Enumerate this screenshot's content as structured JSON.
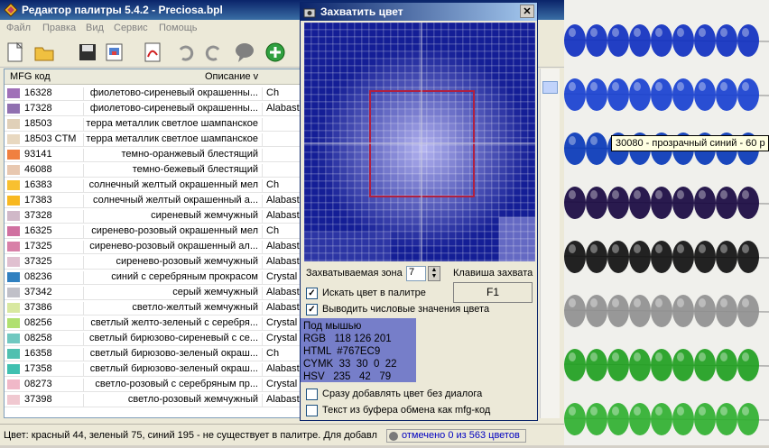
{
  "window": {
    "title": "Редактор палитры 5.4.2 - Preciosa.bpl"
  },
  "menu": [
    "Файл",
    "Правка",
    "Вид",
    "Сервис",
    "Помощь"
  ],
  "grid": {
    "col_code": "MFG код",
    "col_desc": "Описание v",
    "rows": [
      {
        "color": "#a070b8",
        "code": "16328",
        "desc": "фиолетово-сиреневый окрашенны...",
        "extra": "Ch"
      },
      {
        "color": "#9070b0",
        "code": "17328",
        "desc": "фиолетово-сиреневый окрашенны...",
        "extra": "Alabast"
      },
      {
        "color": "#e0d0b8",
        "code": "18503",
        "desc": "терра металлик светлое шампанское",
        "extra": ""
      },
      {
        "color": "#e8d8c0",
        "code": "18503 CTM",
        "desc": "терра металлик светлое шампанское",
        "extra": ""
      },
      {
        "color": "#f08040",
        "code": "93141",
        "desc": "темно-оранжевый блестящий",
        "extra": ""
      },
      {
        "color": "#e8c8b0",
        "code": "46088",
        "desc": "темно-бежевый блестящий",
        "extra": ""
      },
      {
        "color": "#f8c030",
        "code": "16383",
        "desc": "солнечный желтый окрашенный мел",
        "extra": "Ch"
      },
      {
        "color": "#f8b820",
        "code": "17383",
        "desc": "солнечный желтый окрашенный а...",
        "extra": "Alabast"
      },
      {
        "color": "#d0b8c8",
        "code": "37328",
        "desc": "сиреневый жемчужный",
        "extra": "Alabast"
      },
      {
        "color": "#d070a0",
        "code": "16325",
        "desc": "сиренево-розовый окрашенный мел",
        "extra": "Ch"
      },
      {
        "color": "#d880a8",
        "code": "17325",
        "desc": "сиренево-розовый окрашенный ал...",
        "extra": "Alabast"
      },
      {
        "color": "#e0c0d0",
        "code": "37325",
        "desc": "сиренево-розовый жемчужный",
        "extra": "Alabast"
      },
      {
        "color": "#3080c0",
        "code": "08236",
        "desc": "синий с серебряным прокрасом",
        "extra": "Crystal"
      },
      {
        "color": "#c0c0c8",
        "code": "37342",
        "desc": "серый жемчужный",
        "extra": "Alabast"
      },
      {
        "color": "#d8e8a0",
        "code": "37386",
        "desc": "светло-желтый жемчужный",
        "extra": "Alabast"
      },
      {
        "color": "#b0e070",
        "code": "08256",
        "desc": "светлый желто-зеленый с серебря...",
        "extra": "Crystal"
      },
      {
        "color": "#70c8c0",
        "code": "08258",
        "desc": "светлый бирюзово-сиреневый с се...",
        "extra": "Crystal"
      },
      {
        "color": "#50c0b0",
        "code": "16358",
        "desc": "светлый бирюзово-зеленый окраш...",
        "extra": "Ch"
      },
      {
        "color": "#40c0b0",
        "code": "17358",
        "desc": "светлый бирюзово-зеленый окраш...",
        "extra": "Alabast"
      },
      {
        "color": "#f0b8c8",
        "code": "08273",
        "desc": "светло-розовый с серебряным пр...",
        "extra": "Crystal"
      },
      {
        "color": "#f0c8d0",
        "code": "37398",
        "desc": "светло-розовый жемчужный",
        "extra": "Alabast"
      }
    ]
  },
  "status": {
    "text": "Цвет: красный 44, зеленый 75, синий 195 - не существует в палитре. Для добавл",
    "count": "отмечено 0 из 563 цветов"
  },
  "dialog": {
    "title": "Захватить цвет",
    "zone_label": "Захватываемая зона",
    "zone_value": "7",
    "hotkey_label": "Клавиша захвата",
    "hotkey_value": "F1",
    "search_label": "Искать цвет в палитре",
    "search_checked": true,
    "numeric_label": "Выводить числовые значения цвета",
    "numeric_checked": true,
    "info_lines": [
      "Под мышью",
      "RGB   118 126 201",
      "HTML  #767EC9",
      "CYMK  33  30  0  22",
      "HSV   235   42   79"
    ],
    "info_color": "#767EC9",
    "add_label": "Сразу добавлять цвет без диалога",
    "add_checked": false,
    "clipboard_label": "Текст из буфера обмена как mfg-код",
    "clipboard_checked": false
  },
  "tooltip": "30080 - прозрачный синий  - 60 p",
  "bead_colors": [
    "#1030c0",
    "#1840d0",
    "#0838b8",
    "#180840",
    "#101010",
    "#909090",
    "#20a020",
    "#30b030"
  ]
}
